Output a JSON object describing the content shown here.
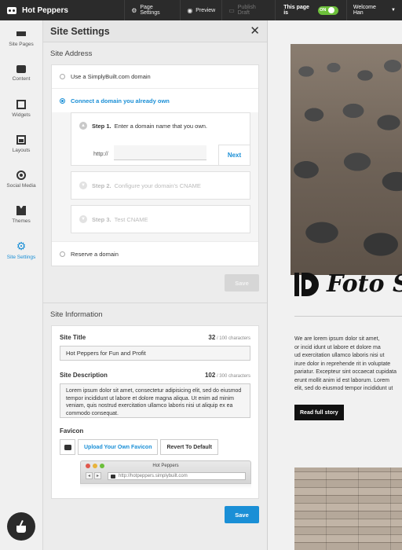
{
  "topbar": {
    "site_name": "Hot Peppers",
    "page_settings": "Page Settings",
    "preview": "Preview",
    "publish_draft": "Publish Draft",
    "live_label": "This page is",
    "live_toggle": "ON",
    "user": "Welcome Han"
  },
  "rail": {
    "items": [
      {
        "label": "Site Pages",
        "icon": "pages-icon"
      },
      {
        "label": "Content",
        "icon": "content-icon"
      },
      {
        "label": "Widgets",
        "icon": "widgets-icon"
      },
      {
        "label": "Layouts",
        "icon": "layouts-icon"
      },
      {
        "label": "Social Media",
        "icon": "social-media-icon"
      },
      {
        "label": "Themes",
        "icon": "themes-icon"
      },
      {
        "label": "Site Settings",
        "icon": "gear-icon",
        "active": true
      }
    ]
  },
  "panel": {
    "title": "Site Settings",
    "address_section": "Site Address",
    "options": {
      "simplybuilt": "Use a SimplyBuilt.com domain",
      "connect": "Connect a domain you already own",
      "reserve": "Reserve a domain"
    },
    "steps": [
      {
        "num": "Step 1.",
        "text": "Enter a domain name that you own."
      },
      {
        "num": "Step 2.",
        "text": "Configure your domain's CNAME"
      },
      {
        "num": "Step 3.",
        "text": "Test CNAME"
      }
    ],
    "url_prefix": "http://",
    "url_value": "",
    "next": "Next",
    "save": "Save",
    "info_section": "Site Information",
    "site_title_label": "Site Title",
    "site_title_count": "32",
    "site_title_limit": "/ 100 characters",
    "site_title_value": "Hot Peppers for Fun and Profit",
    "site_desc_label": "Site Description",
    "site_desc_count": "102",
    "site_desc_limit": "/ 300 characters",
    "site_desc_value": "Lorem ipsum dolor sit amet, consectetur adipisicing elit, sed do eiusmod tempor incididunt ut labore et dolore magna aliqua. Ut enim ad minim veniam, quis nostrud exercitation ullamco laboris nisi ut aliquip ex ea commodo consequat.",
    "favicon_label": "Favicon",
    "upload_favicon": "Upload Your Own Favicon",
    "revert_default": "Revert To Default",
    "browser_title": "Hot Peppers",
    "browser_url": "http://hotpeppers.simplybuilt.com",
    "save_bottom": "Save"
  },
  "preview": {
    "brand": "Foto St",
    "body": "We are lorem ipsum dolor sit amet,\nor incid idunt ut labore et dolore ma\nud exercitation ullamco laboris nisi ut\nirure dolor in reprehende rit in voluptate\npariatur. Excepteur sint occaecat cupidata\nerunt mollit anim id est laborum. Lorem\nelit, sed do eiusmod tempor incididunt ut",
    "read_more": "Read full story"
  },
  "colors": {
    "accent": "#1a8fd6",
    "topbar": "#2b2b2b",
    "toggle_on": "#6cbf3a"
  }
}
